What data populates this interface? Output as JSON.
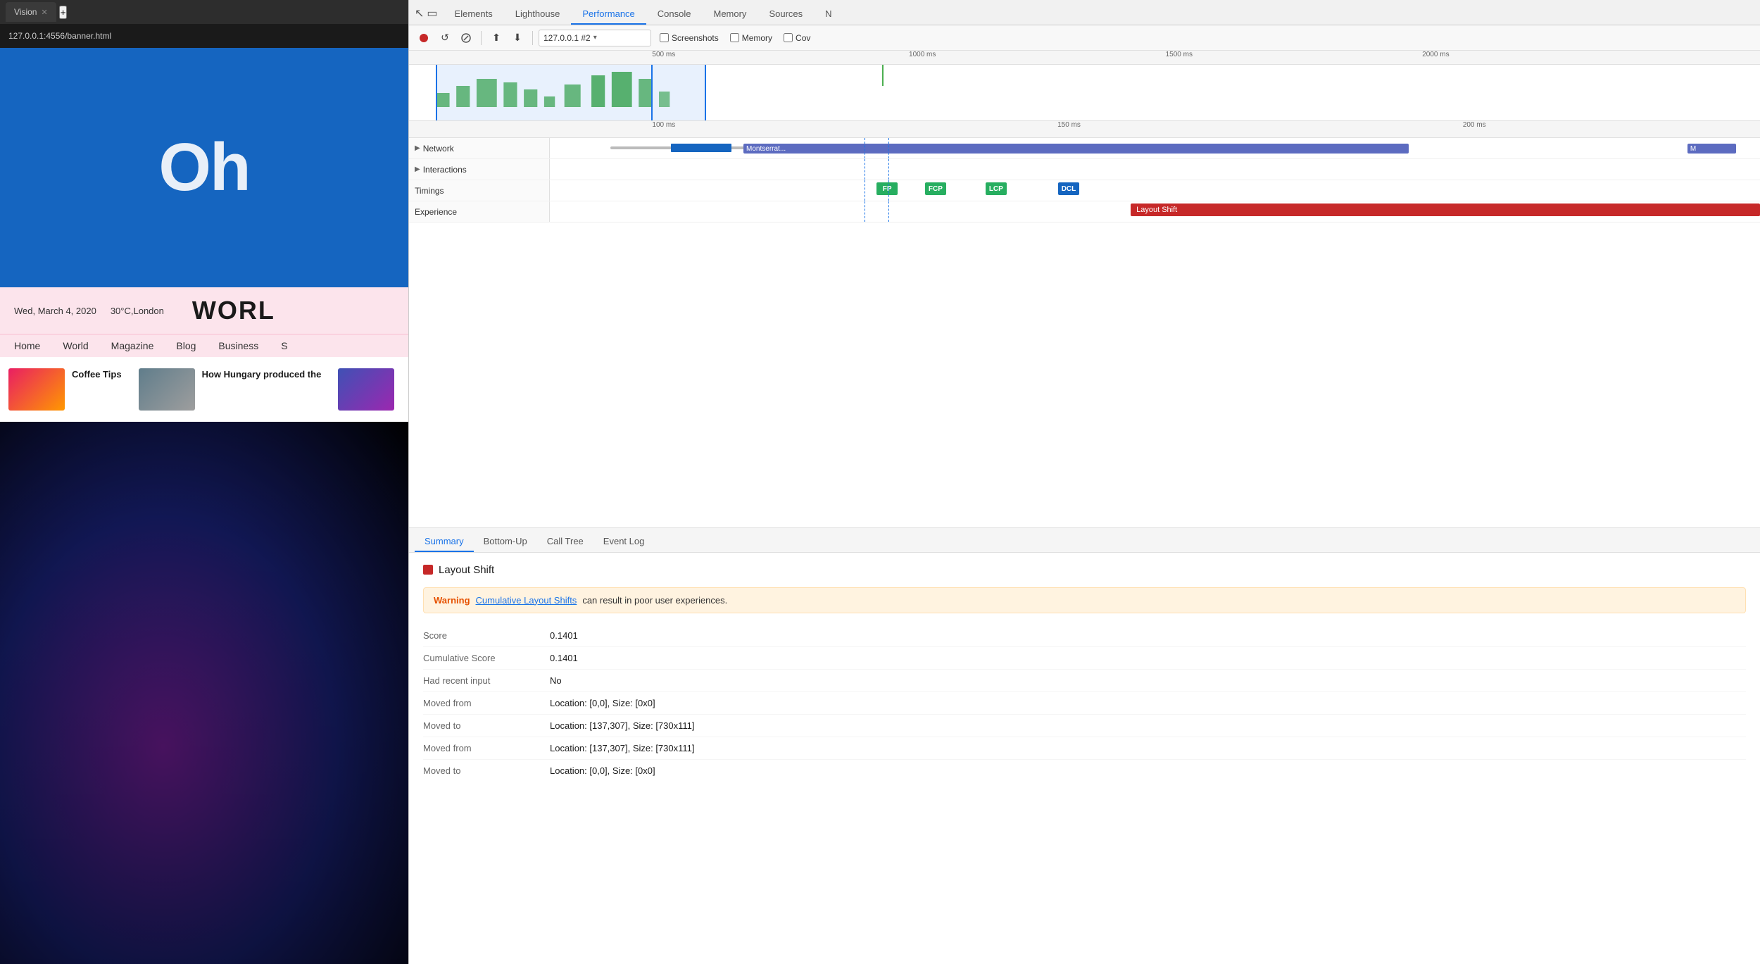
{
  "browser": {
    "tab_title": "Vision",
    "address": "127.0.0.1:4556/banner.html",
    "new_tab_label": "+"
  },
  "webpage": {
    "hero_text": "Oh",
    "date": "Wed, March 4, 2020",
    "weather": "30°C,London",
    "site_title": "WORL",
    "nav_items": [
      "Home",
      "World",
      "Magazine",
      "Blog",
      "Business",
      "S"
    ],
    "card1_title": "Coffee Tips",
    "card2_title": "How Hungary produced the",
    "concert_section": ""
  },
  "devtools": {
    "tabs": [
      {
        "label": "Elements",
        "active": false
      },
      {
        "label": "Lighthouse",
        "active": false
      },
      {
        "label": "Performance",
        "active": true
      },
      {
        "label": "Console",
        "active": false
      },
      {
        "label": "Memory",
        "active": false
      },
      {
        "label": "Sources",
        "active": false
      },
      {
        "label": "N",
        "active": false
      }
    ],
    "toolbar": {
      "record_label": "●",
      "refresh_label": "↺",
      "clear_label": "🚫",
      "upload_label": "⬆",
      "download_label": "⬇",
      "profile_select": "127.0.0.1 #2",
      "screenshots_label": "Screenshots",
      "memory_label": "Memory",
      "coverage_label": "Cov"
    },
    "overview_ruler_marks": [
      "500 ms",
      "1000 ms",
      "1500 ms",
      "2000 ms"
    ],
    "detail_ruler_marks": [
      "100 ms",
      "150 ms",
      "200 ms"
    ],
    "tracks": [
      {
        "label": "Network",
        "arrow": true
      },
      {
        "label": "Interactions",
        "arrow": true
      },
      {
        "label": "Timings",
        "arrow": false
      },
      {
        "label": "Experience",
        "arrow": false
      }
    ],
    "network_bar": {
      "label": "Montserrat...",
      "label2": "M"
    },
    "timings": [
      {
        "label": "FP",
        "class": "badge-fp"
      },
      {
        "label": "FCP",
        "class": "badge-fcp"
      },
      {
        "label": "LCP",
        "class": "badge-lcp"
      },
      {
        "label": "DCL",
        "class": "badge-dcl"
      }
    ],
    "experience_bar_label": "Layout Shift",
    "bottom_tabs": [
      {
        "label": "Summary",
        "active": true
      },
      {
        "label": "Bottom-Up",
        "active": false
      },
      {
        "label": "Call Tree",
        "active": false
      },
      {
        "label": "Event Log",
        "active": false
      }
    ],
    "detail": {
      "title": "Layout Shift",
      "warning_label": "Warning",
      "warning_link": "Cumulative Layout Shifts",
      "warning_text": "can result in poor user experiences.",
      "rows": [
        {
          "key": "Score",
          "value": "0.1401"
        },
        {
          "key": "Cumulative Score",
          "value": "0.1401"
        },
        {
          "key": "Had recent input",
          "value": "No"
        },
        {
          "key": "Moved from",
          "value": "Location: [0,0], Size: [0x0]"
        },
        {
          "key": "Moved to",
          "value": "Location: [137,307], Size: [730x111]"
        },
        {
          "key": "Moved from",
          "value": "Location: [137,307], Size: [730x111]"
        },
        {
          "key": "Moved to",
          "value": "Location: [0,0], Size: [0x0]"
        }
      ]
    }
  }
}
